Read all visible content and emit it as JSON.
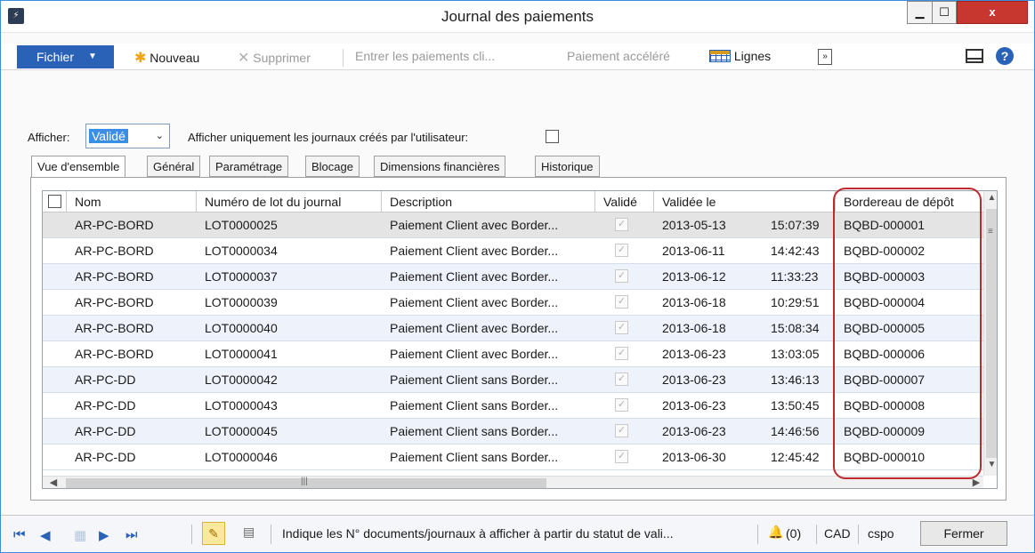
{
  "window": {
    "title": "Journal des paiements",
    "icon_text": "⚡",
    "close_label": "x"
  },
  "toolbar": {
    "file_label": "Fichier",
    "new_label": "Nouveau",
    "delete_label": "Supprimer",
    "enter_payments_label": "Entrer les paiements cli...",
    "quick_payment_label": "Paiement accéléré",
    "lines_label": "Lignes",
    "more_label": "»"
  },
  "filter": {
    "afficher_label": "Afficher:",
    "afficher_value": "Validé",
    "only_user_label": "Afficher uniquement les journaux créés par l'utilisateur:"
  },
  "tabs": [
    "Vue d'ensemble",
    "Général",
    "Paramétrage",
    "Blocage",
    "Dimensions financières",
    "Historique"
  ],
  "grid": {
    "columns": [
      "Nom",
      "Numéro de lot du journal",
      "Description",
      "Validé",
      "Validée le",
      "Bordereau de dépôt"
    ],
    "rows": [
      {
        "nom": "AR-PC-BORD",
        "lot": "LOT0000025",
        "desc": "Paiement Client avec Border...",
        "date": "2013-05-13",
        "time": "15:07:39",
        "bord": "BQBD-000001"
      },
      {
        "nom": "AR-PC-BORD",
        "lot": "LOT0000034",
        "desc": "Paiement Client avec Border...",
        "date": "2013-06-11",
        "time": "14:42:43",
        "bord": "BQBD-000002"
      },
      {
        "nom": "AR-PC-BORD",
        "lot": "LOT0000037",
        "desc": "Paiement Client avec Border...",
        "date": "2013-06-12",
        "time": "11:33:23",
        "bord": "BQBD-000003"
      },
      {
        "nom": "AR-PC-BORD",
        "lot": "LOT0000039",
        "desc": "Paiement Client avec Border...",
        "date": "2013-06-18",
        "time": "10:29:51",
        "bord": "BQBD-000004"
      },
      {
        "nom": "AR-PC-BORD",
        "lot": "LOT0000040",
        "desc": "Paiement Client avec Border...",
        "date": "2013-06-18",
        "time": "15:08:34",
        "bord": "BQBD-000005"
      },
      {
        "nom": "AR-PC-BORD",
        "lot": "LOT0000041",
        "desc": "Paiement Client avec Border...",
        "date": "2013-06-23",
        "time": "13:03:05",
        "bord": "BQBD-000006"
      },
      {
        "nom": "AR-PC-DD",
        "lot": "LOT0000042",
        "desc": "Paiement Client sans Border...",
        "date": "2013-06-23",
        "time": "13:46:13",
        "bord": "BQBD-000007"
      },
      {
        "nom": "AR-PC-DD",
        "lot": "LOT0000043",
        "desc": "Paiement Client sans Border...",
        "date": "2013-06-23",
        "time": "13:50:45",
        "bord": "BQBD-000008"
      },
      {
        "nom": "AR-PC-DD",
        "lot": "LOT0000045",
        "desc": "Paiement Client sans Border...",
        "date": "2013-06-23",
        "time": "14:46:56",
        "bord": "BQBD-000009"
      },
      {
        "nom": "AR-PC-DD",
        "lot": "LOT0000046",
        "desc": "Paiement Client sans Border...",
        "date": "2013-06-30",
        "time": "12:45:42",
        "bord": "BQBD-000010"
      }
    ]
  },
  "status": {
    "help_text": "Indique les N° documents/journaux à afficher à partir du statut de vali...",
    "notifications": "(0)",
    "currency": "CAD",
    "company": "cspo",
    "close_label": "Fermer"
  },
  "colors": {
    "accent": "#2a62b8",
    "highlight": "#c0292f",
    "row_alt": "#eef3fb"
  }
}
